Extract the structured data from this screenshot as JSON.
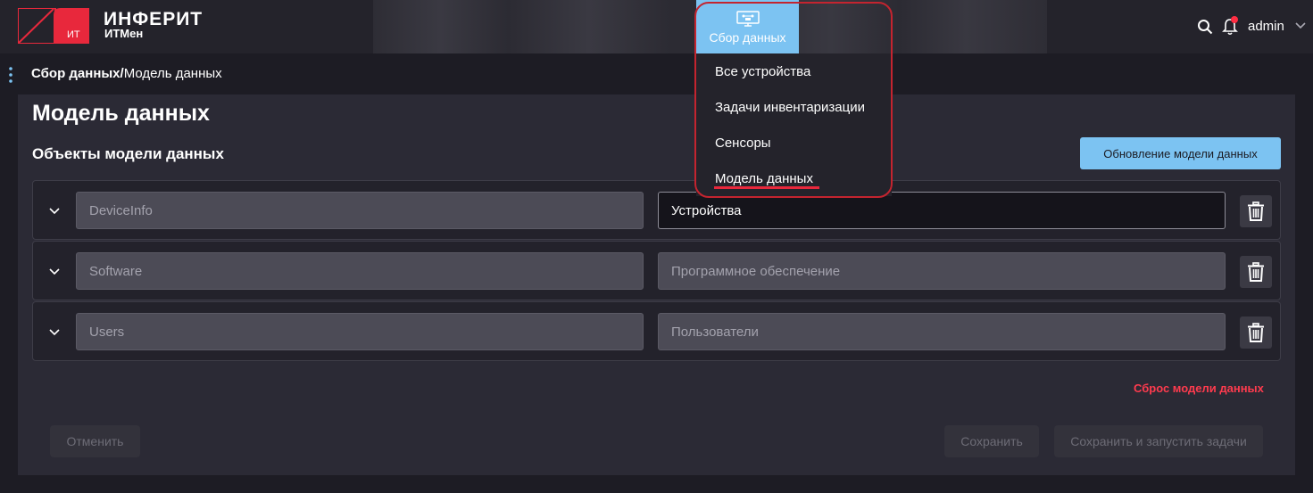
{
  "brand": {
    "name": "ИНФЕРИТ",
    "product": "ИТМен",
    "logo_text": "ИТ"
  },
  "nav": {
    "active_label": "Сбор данных"
  },
  "user": {
    "name": "admin"
  },
  "breadcrumb": {
    "parent": "Сбор данных",
    "separator": "/",
    "current": "Модель данных"
  },
  "dropdown": {
    "items": [
      {
        "label": "Все устройства"
      },
      {
        "label": "Задачи инвентаризации"
      },
      {
        "label": "Сенсоры"
      },
      {
        "label": "Модель данных",
        "selected": true
      }
    ]
  },
  "page": {
    "title": "Модель данных",
    "section_title": "Объекты модели данных",
    "update_button": "Обновление модели данных",
    "rows": [
      {
        "name": "DeviceInfo",
        "alias": "Устройства",
        "alias_focused": true
      },
      {
        "name": "Software",
        "alias": "Программное обеспечение",
        "alias_focused": false
      },
      {
        "name": "Users",
        "alias": "Пользователи",
        "alias_focused": false
      }
    ],
    "reset_link": "Сброс модели данных",
    "cancel_button": "Отменить",
    "save_button": "Сохранить",
    "save_run_button": "Сохранить и запустить задачи"
  },
  "colors": {
    "accent": "#7cc3f2",
    "danger": "#ff3b4e",
    "background": "#1d1c24",
    "card": "#2b2a35"
  },
  "icons": {
    "search": "search-icon",
    "notifications": "bell-icon",
    "delete": "trash-icon",
    "expand": "chevron-down-icon",
    "menu": "kebab-icon",
    "data_collection": "monitor-icon"
  }
}
